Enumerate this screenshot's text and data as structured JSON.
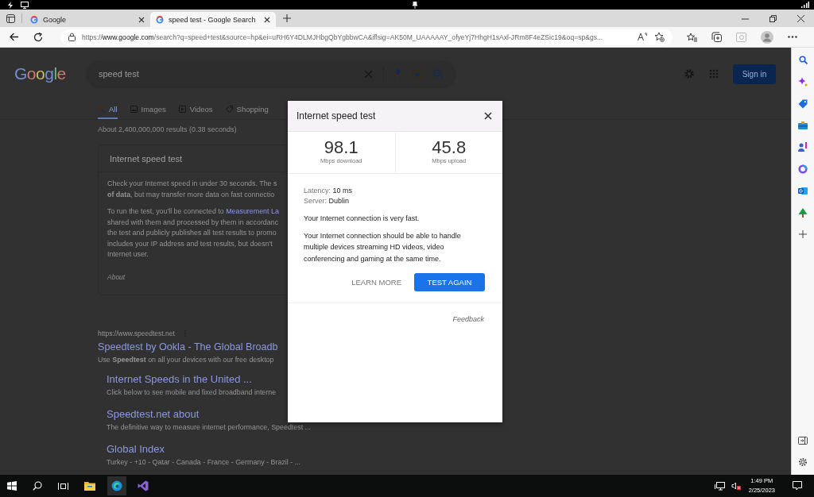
{
  "tabs": [
    {
      "title": "Google",
      "selected": false
    },
    {
      "title": "speed test - Google Search",
      "selected": true
    }
  ],
  "address_bar": {
    "scheme": "https://",
    "host": "www.google.com",
    "path": "/search?q=speed+test&source=hp&ei=uRH6Y4DLMJHbgQbYgbbwCA&iflsig=AK50M_UAAAAAY_ofyeYj7HhgH1sAxl-JRm8F4eZSic19&oq=sp&gs..."
  },
  "google": {
    "logo": "Google",
    "query": "speed test",
    "sign_in": "Sign in",
    "tabs": [
      {
        "label": "All",
        "selected": true
      },
      {
        "label": "Images",
        "selected": false
      },
      {
        "label": "Videos",
        "selected": false
      },
      {
        "label": "Shopping",
        "selected": false
      }
    ],
    "result_stats": "About 2,400,000,000 results (0.38 seconds)",
    "answer_card": {
      "title": "Internet speed test",
      "paragraphs": [
        [
          {
            "text": "Check your Internet speed in under 30 seconds. The s"
          },
          {
            "text": "**of data**, but may transfer more data on fast connectio"
          }
        ],
        [
          {
            "text": "To run the test, you'll be connected to ",
            "link": "Measurement La"
          },
          {
            "text": "shared with them and processed by them in accordanc"
          },
          {
            "text": "the test and publicly publishes all test results to promo"
          },
          {
            "text": "includes your IP address and test results, but doesn't"
          },
          {
            "text": "Internet user."
          }
        ]
      ],
      "about": "About"
    },
    "result": {
      "url": "https://www.speedtest.net",
      "title": "Speedtest by Ookla - The Global Broadb",
      "snippet": "Use **Speedtest** on all your devices with our free desktop",
      "sitelinks": [
        {
          "title": "Internet Speeds in the United ...",
          "snippet": "Click below to see mobile and fixed broadband interne"
        },
        {
          "title": "Speedtest.net about",
          "snippet": "The definitive way to measure internet performance, Speedtest ..."
        },
        {
          "title": "Global Index",
          "snippet": "Turkey - +10 - Qatar - Canada - France - Germany - Brazil - ..."
        }
      ]
    }
  },
  "dialog": {
    "title": "Internet speed test",
    "stats": [
      {
        "value": "98.1",
        "unit": "Mbps download"
      },
      {
        "value": "45.8",
        "unit": "Mbps upload"
      }
    ],
    "details": [
      {
        "label": "Latency:",
        "value": "10 ms"
      },
      {
        "label": "Server:",
        "value": "Dublin"
      }
    ],
    "verdict": "Your Internet connection is very fast.",
    "description": "Your Internet connection should be able to handle multiple devices streaming HD videos, video conferencing and gaming at the same time.",
    "buttons": [
      {
        "label": "LEARN MORE",
        "kind": "text"
      },
      {
        "label": "TEST AGAIN",
        "kind": "primary"
      }
    ],
    "feedback": "Feedback"
  },
  "taskbar": {
    "time": "1:49 PM",
    "date": "2/25/2023"
  }
}
